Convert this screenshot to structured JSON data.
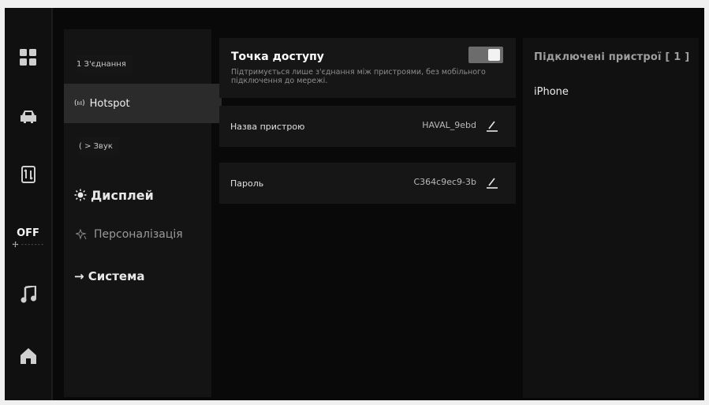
{
  "rail": {
    "climate_status": "OFF"
  },
  "menu": {
    "connection_label": "1 З'єднання",
    "hotspot_icon_glyph": "(ıᵢı)",
    "hotspot_label": "Hotspot",
    "sound_label": "( > Звук",
    "display_label": "Дисплей",
    "personalization_label": "Персоналізація",
    "system_label": "→ Система"
  },
  "hotspot": {
    "title": "Точка доступу",
    "description": "Підтримується лише з'єднання між пристроями, без мобільного підключення до мережі.",
    "enabled": true
  },
  "device_name": {
    "label": "Назва пристрою",
    "value": "HAVAL_9ebd"
  },
  "password": {
    "label": "Пароль",
    "value": "C364c9ec9-3b"
  },
  "connected": {
    "title": "Підключені пристрої [ 1 ]",
    "devices": [
      "iPhone"
    ]
  },
  "colors": {
    "background": "#090909",
    "panel": "#161616",
    "menu_active": "#2b2b2b",
    "toggle_track": "#6c6c6c"
  },
  "icons": [
    "apps-grid-icon",
    "car-icon",
    "phone-link-icon",
    "fan-icon",
    "music-note-icon",
    "home-icon",
    "wireless-antenna-icon",
    "sun-icon",
    "sparkle-icon",
    "pencil-icon"
  ]
}
